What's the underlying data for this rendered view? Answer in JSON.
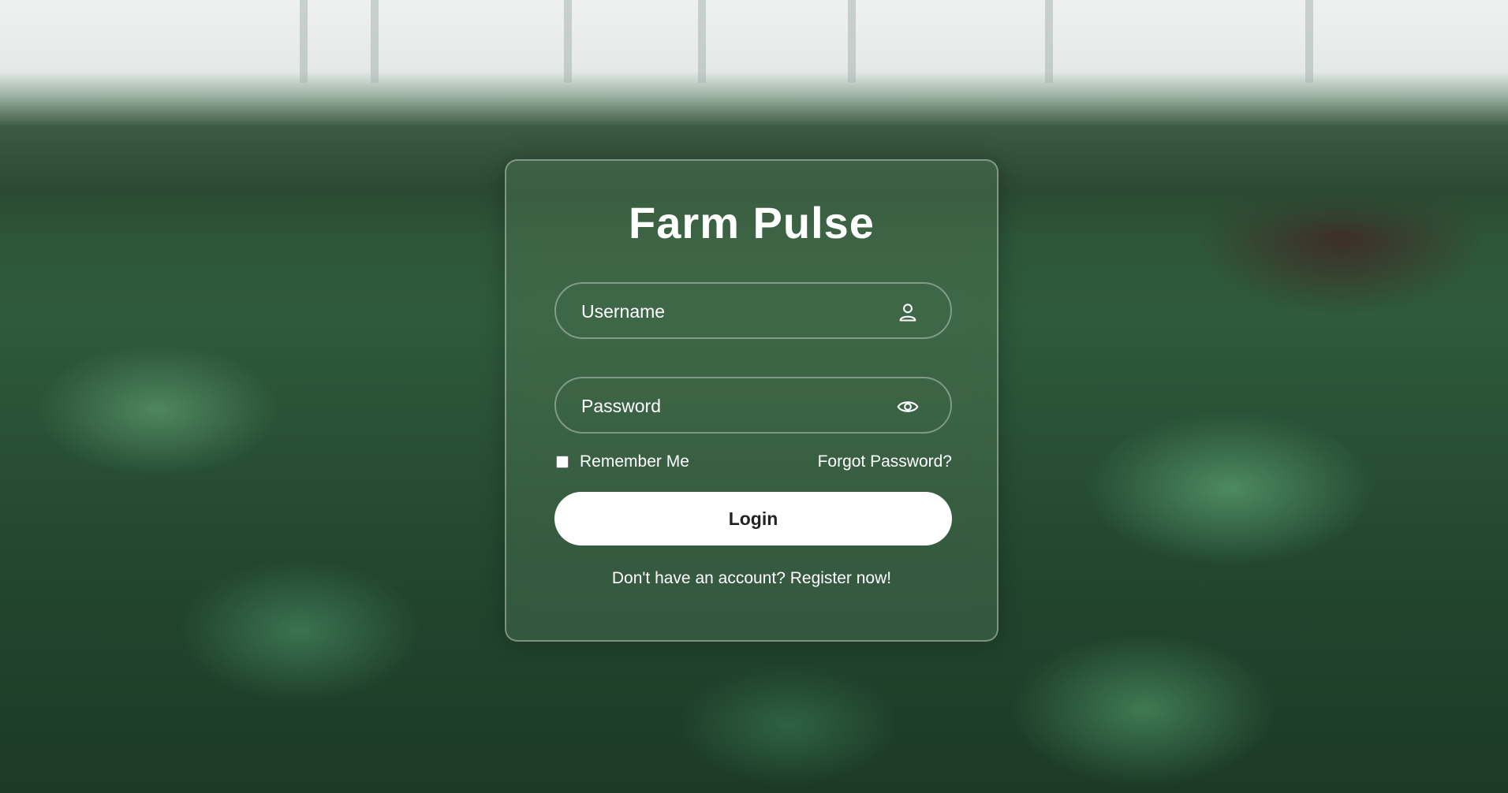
{
  "app": {
    "title": "Farm Pulse"
  },
  "login_form": {
    "username_placeholder": "Username",
    "username_value": "",
    "username_icon": "user-icon",
    "password_placeholder": "Password",
    "password_value": "",
    "password_icon": "eye-icon",
    "remember_label": "Remember Me",
    "remember_checked": false,
    "forgot_label": "Forgot Password?",
    "login_label": "Login",
    "register_prompt": "Don't have an account?",
    "register_link": "Register now!"
  },
  "colors": {
    "text": "#ffffff",
    "button_bg": "#ffffff",
    "button_text": "#222222",
    "card_border": "rgba(255,255,255,0.35)"
  }
}
